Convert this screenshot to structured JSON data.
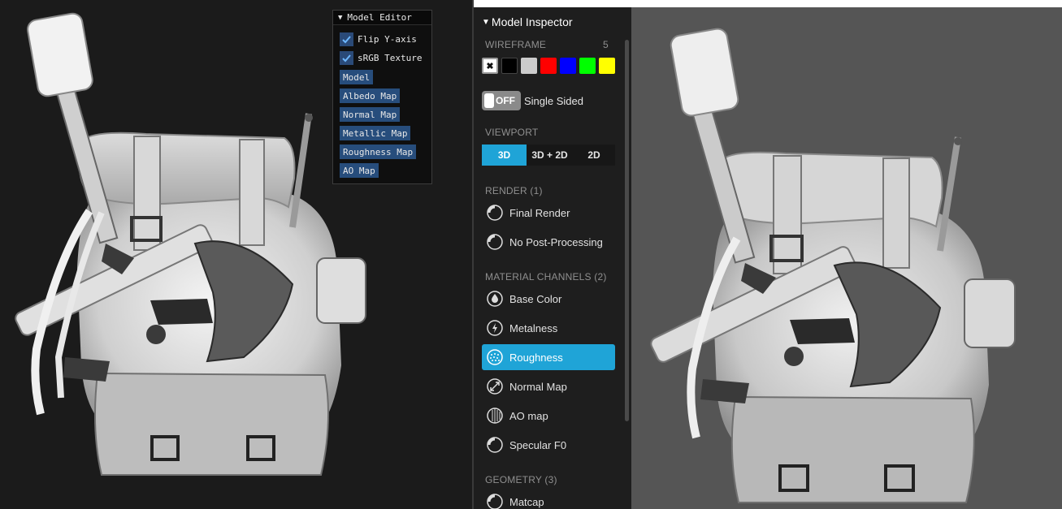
{
  "model_editor": {
    "title": "Model Editor",
    "checkboxes": [
      {
        "label": "Flip Y-axis",
        "checked": true
      },
      {
        "label": "sRGB Texture",
        "checked": true
      }
    ],
    "buttons": [
      "Model",
      "Albedo Map",
      "Normal Map",
      "Metallic Map",
      "Roughness Map",
      "AO Map"
    ]
  },
  "inspector": {
    "title": "Model Inspector",
    "wireframe": {
      "label": "WIREFRAME",
      "count": "5",
      "colors": [
        "#ffffff",
        "#000000",
        "#cccccc",
        "#ff0000",
        "#0000ff",
        "#00ff00",
        "#ffff00"
      ]
    },
    "single_sided": {
      "toggle_text": "OFF",
      "label": "Single Sided"
    },
    "viewport": {
      "label": "VIEWPORT",
      "options": [
        "3D",
        "3D + 2D",
        "2D"
      ],
      "selected": "3D"
    },
    "render": {
      "label": "RENDER (1)",
      "items": [
        "Final Render",
        "No Post-Processing"
      ]
    },
    "material": {
      "label": "MATERIAL CHANNELS (2)",
      "items": [
        "Base Color",
        "Metalness",
        "Roughness",
        "Normal Map",
        "AO map",
        "Specular F0"
      ],
      "selected": "Roughness"
    },
    "geometry": {
      "label": "GEOMETRY (3)",
      "items": [
        "Matcap"
      ]
    }
  },
  "colors": {
    "accent": "#1fa4d7",
    "panel_bg": "#1e1e1e",
    "viewport_bg": "#555555",
    "editor_button": "#274d7c"
  }
}
